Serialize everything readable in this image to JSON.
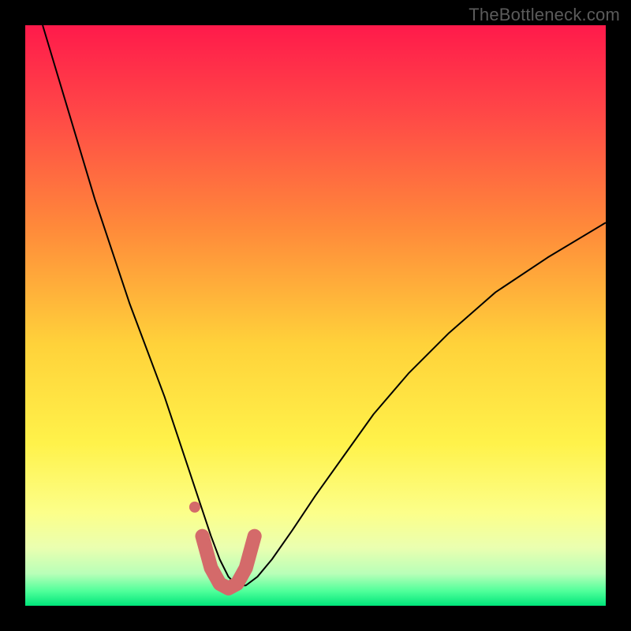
{
  "watermark": "TheBottleneck.com",
  "chart_data": {
    "type": "line",
    "title": "",
    "xlabel": "",
    "ylabel": "",
    "xlim": [
      0,
      100
    ],
    "ylim": [
      0,
      100
    ],
    "grid": false,
    "legend": false,
    "background_gradient_stops": [
      {
        "offset": 0.0,
        "color": "#ff1a4b"
      },
      {
        "offset": 0.15,
        "color": "#ff4747"
      },
      {
        "offset": 0.35,
        "color": "#ff8a3a"
      },
      {
        "offset": 0.55,
        "color": "#ffd23a"
      },
      {
        "offset": 0.72,
        "color": "#fff24a"
      },
      {
        "offset": 0.84,
        "color": "#fcff8a"
      },
      {
        "offset": 0.9,
        "color": "#eaffb0"
      },
      {
        "offset": 0.945,
        "color": "#b8ffb8"
      },
      {
        "offset": 0.975,
        "color": "#4fff9a"
      },
      {
        "offset": 1.0,
        "color": "#00e57a"
      }
    ],
    "series": [
      {
        "name": "bottleneck-curve",
        "color": "#000000",
        "width": 2,
        "x": [
          3,
          6,
          9,
          12,
          15,
          18,
          21,
          24,
          26,
          28,
          30,
          32,
          33.5,
          35,
          36.5,
          38,
          40,
          42.5,
          46,
          50,
          55,
          60,
          66,
          73,
          81,
          90,
          100
        ],
        "values": [
          100,
          90,
          80,
          70,
          61,
          52,
          44,
          36,
          30,
          24,
          18,
          12,
          8,
          5,
          3.5,
          3.5,
          5,
          8,
          13,
          19,
          26,
          33,
          40,
          47,
          54,
          60,
          66
        ]
      },
      {
        "name": "highlight-band",
        "color": "#d46a6a",
        "width": 18,
        "linecap": "round",
        "x": [
          30.5,
          32,
          33.5,
          35,
          36.5,
          38,
          39.5
        ],
        "values": [
          12,
          6.5,
          3.8,
          3,
          3.8,
          6.5,
          12
        ]
      }
    ],
    "markers": [
      {
        "name": "highlight-dot",
        "x": 29.2,
        "y": 17,
        "r": 7,
        "color": "#d46a6a"
      }
    ]
  }
}
